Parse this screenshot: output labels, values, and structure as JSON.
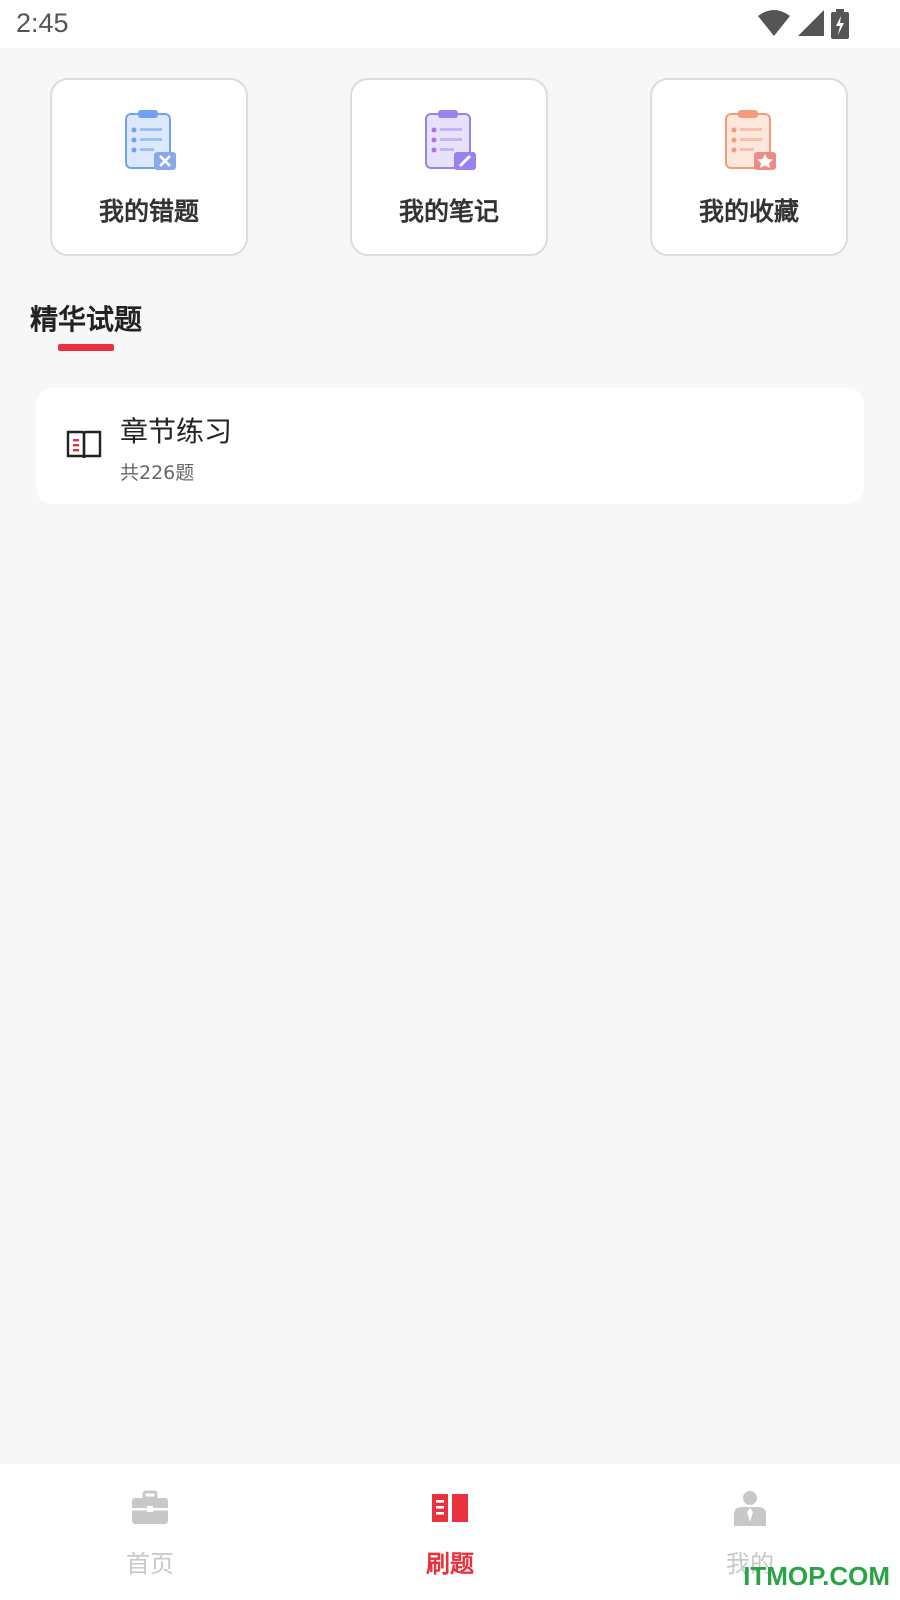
{
  "status_bar": {
    "time": "2:45",
    "icons": [
      "wifi-icon",
      "cellular-signal-icon",
      "battery-charging-icon"
    ]
  },
  "quick_actions": [
    {
      "label": "我的错题",
      "icon": "wrong-questions-clipboard-icon",
      "accent": "#6fa2f2"
    },
    {
      "label": "我的笔记",
      "icon": "notes-clipboard-icon",
      "accent": "#9a82ee"
    },
    {
      "label": "我的收藏",
      "icon": "favorites-clipboard-icon",
      "accent": "#f29c7c"
    }
  ],
  "section": {
    "title": "精华试题",
    "underline_color": "#e8303e"
  },
  "practice_items": [
    {
      "title": "章节练习",
      "subtitle": "共226题",
      "icon": "open-book-icon"
    }
  ],
  "tabs": [
    {
      "label": "首页",
      "icon": "briefcase-icon",
      "active": false
    },
    {
      "label": "刷题",
      "icon": "book-icon",
      "active": true
    },
    {
      "label": "我的",
      "icon": "user-icon",
      "active": false
    }
  ],
  "colors": {
    "accent": "#e8303e",
    "inactive": "#c8c8c8",
    "background": "#f7f7f7"
  },
  "watermark": "ITMOP.COM"
}
